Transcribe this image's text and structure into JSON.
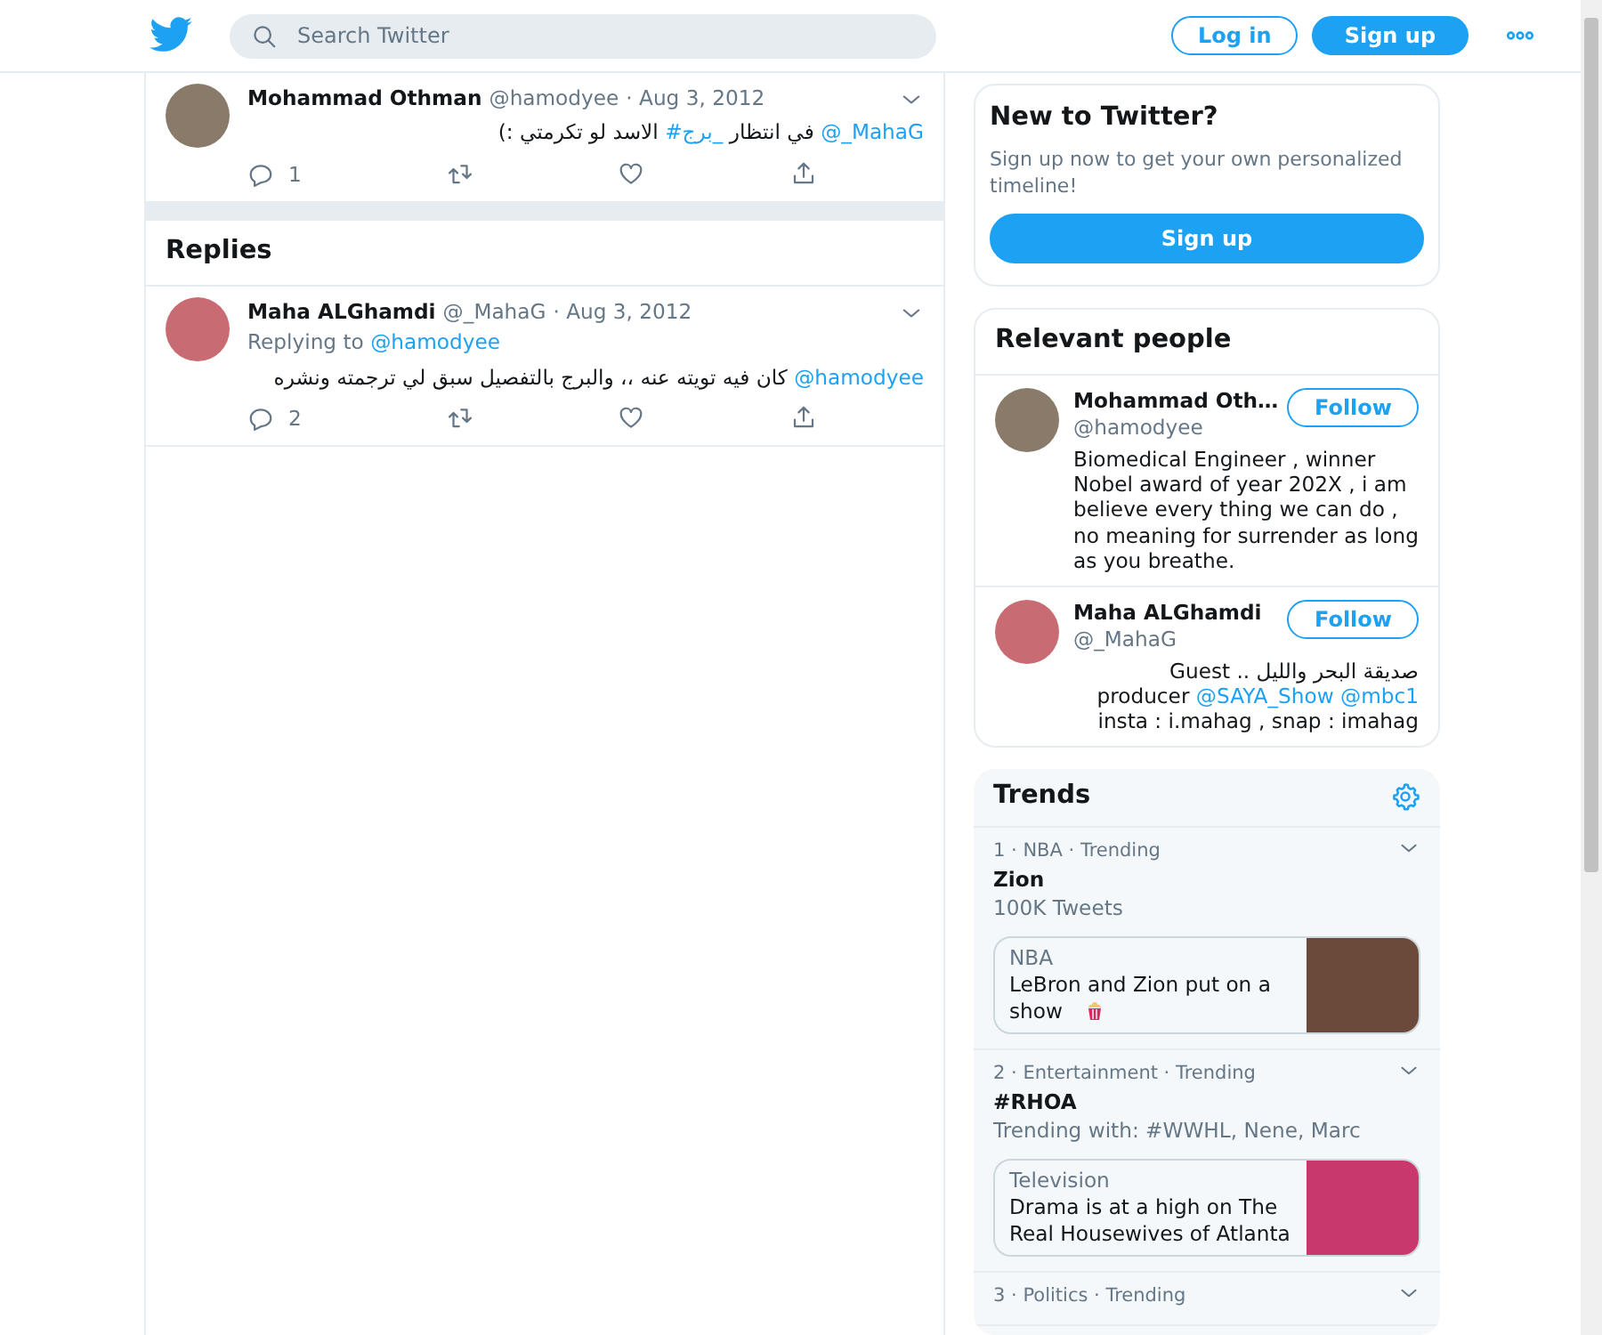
{
  "header": {
    "search": {
      "placeholder": "Search Twitter"
    },
    "login": "Log in",
    "signup": "Sign up"
  },
  "tweet": {
    "name": "Mohammad Othman",
    "handle": "@hamodyee",
    "date": "· Aug 3, 2012",
    "text": [
      {
        "text": "@_MahaG",
        "link": true
      },
      {
        "text": " في انتظار ",
        "link": false
      },
      {
        "text": "#برج_",
        "link": true
      },
      {
        "text": " الاسد لو تكرمتي  :)",
        "link": false
      }
    ],
    "replies": "1"
  },
  "replies_heading": "Replies",
  "replies": [
    {
      "name": "Maha ALGhamdi",
      "handle": "@_MahaG",
      "date": "· Aug 3, 2012",
      "replying_label": "Replying to",
      "replying_to": "@hamodyee",
      "mention": "@hamodyee",
      "body": " كان فيه تويته عنه ،، والبرج بالتفصيل سبق لي ترجمته ونشره",
      "replies": "2"
    }
  ],
  "signup_card": {
    "title": "New to Twitter?",
    "text": "Sign up now to get your own personalized timeline!",
    "button": "Sign up"
  },
  "people": {
    "title": "Relevant people",
    "items": [
      {
        "name": "Mohammad Oth…",
        "handle": "@hamodyee",
        "button": "Follow",
        "rtl": false,
        "bio": [
          {
            "text": "Biomedical Engineer , winner Nobel award of year 202X , i am believe every thing we can do , no meaning for surrender as long as you breathe.",
            "link": false
          }
        ]
      },
      {
        "name": "Maha ALGhamdi",
        "handle": "@_MahaG",
        "button": "Follow",
        "rtl": true,
        "bio": [
          {
            "text": "صديقة البحر والليل .. Guest producer ",
            "link": false
          },
          {
            "text": "@SAYA_Show",
            "link": true
          },
          {
            "text": "@mbc1",
            "link": true
          },
          {
            "text": " insta : i.mahag , snap : imahag",
            "link": false
          }
        ]
      }
    ]
  },
  "trends": {
    "title": "Trends",
    "items": [
      {
        "meta": "1 · NBA · Trending",
        "title": "Zion",
        "subtitle": "100K Tweets",
        "card": {
          "category": "NBA",
          "text": "LeBron and Zion put on a show",
          "popcorn": true
        }
      },
      {
        "meta": "2 · Entertainment · Trending",
        "title": "#RHOA",
        "subtitle": "Trending with: #WWHL, Nene, Marc",
        "card": {
          "category": "Television",
          "text": "Drama is at a high on The Real Housewives of Atlanta",
          "popcorn": false
        }
      },
      {
        "meta": "3 · Politics · Trending"
      }
    ]
  }
}
